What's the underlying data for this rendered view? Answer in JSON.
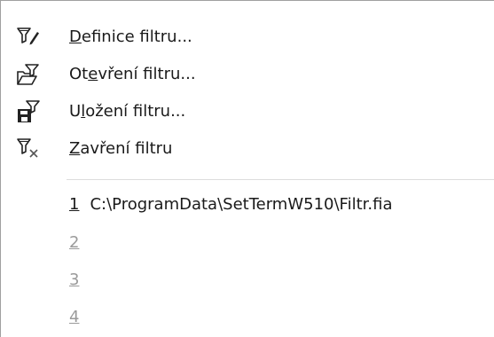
{
  "menu": {
    "items": [
      {
        "pre": "",
        "acc": "D",
        "post": "efinice filtru...",
        "icon": "filter-edit-icon"
      },
      {
        "pre": "Ot",
        "acc": "e",
        "post": "vření filtru...",
        "icon": "filter-open-icon"
      },
      {
        "pre": "U",
        "acc": "l",
        "post": "ožení filtru...",
        "icon": "filter-save-icon"
      },
      {
        "pre": "",
        "acc": "Z",
        "post": "avření filtru",
        "icon": "filter-close-icon"
      }
    ],
    "recent": [
      {
        "num": "1",
        "path": "C:\\ProgramData\\SetTermW510\\Filtr.fia",
        "enabled": true
      },
      {
        "num": "2",
        "path": "",
        "enabled": false
      },
      {
        "num": "3",
        "path": "",
        "enabled": false
      },
      {
        "num": "4",
        "path": "",
        "enabled": false
      }
    ]
  }
}
